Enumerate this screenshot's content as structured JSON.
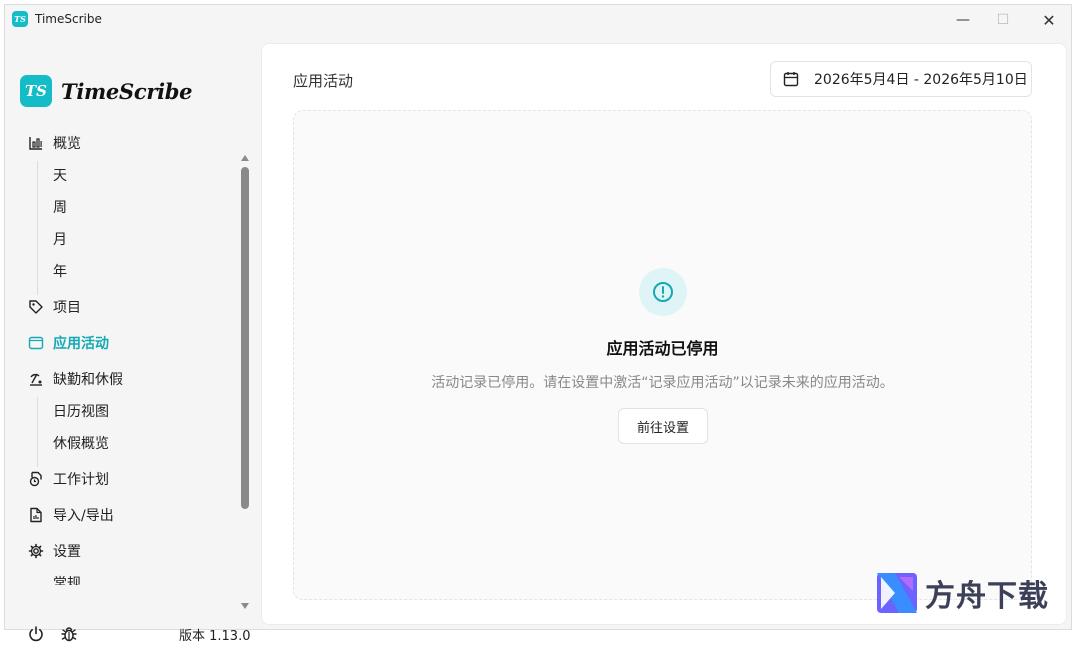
{
  "app": {
    "title": "TimeScribe",
    "logo_text": "TS",
    "brand_name": "TimeScribe"
  },
  "window_controls": {
    "minimize": "—",
    "maximize": "☐",
    "close": "✕"
  },
  "sidebar": {
    "items": [
      {
        "label": "概览",
        "icon": "bar-chart-icon"
      },
      {
        "label": "天"
      },
      {
        "label": "周"
      },
      {
        "label": "月"
      },
      {
        "label": "年"
      },
      {
        "label": "项目",
        "icon": "tag-icon"
      },
      {
        "label": "应用活动",
        "icon": "window-icon",
        "active": true
      },
      {
        "label": "缺勤和休假",
        "icon": "beach-icon"
      },
      {
        "label": "日历视图"
      },
      {
        "label": "休假概览"
      },
      {
        "label": "工作计划",
        "icon": "schedule-icon"
      },
      {
        "label": "导入/导出",
        "icon": "file-icon"
      },
      {
        "label": "设置",
        "icon": "gear-icon"
      },
      {
        "label": "常规"
      }
    ],
    "version": "版本 1.13.0"
  },
  "main": {
    "page_title": "应用活动",
    "date_range": "2026年5月4日 - 2026年5月10日",
    "empty_state": {
      "title": "应用活动已停用",
      "description": "活动记录已停用。请在设置中激活“记录应用活动”以记录未来的应用活动。",
      "button": "前往设置"
    }
  },
  "watermark": {
    "text": "方舟下载"
  },
  "colors": {
    "accent": "#14bcc8",
    "active_text": "#14a9b4"
  }
}
